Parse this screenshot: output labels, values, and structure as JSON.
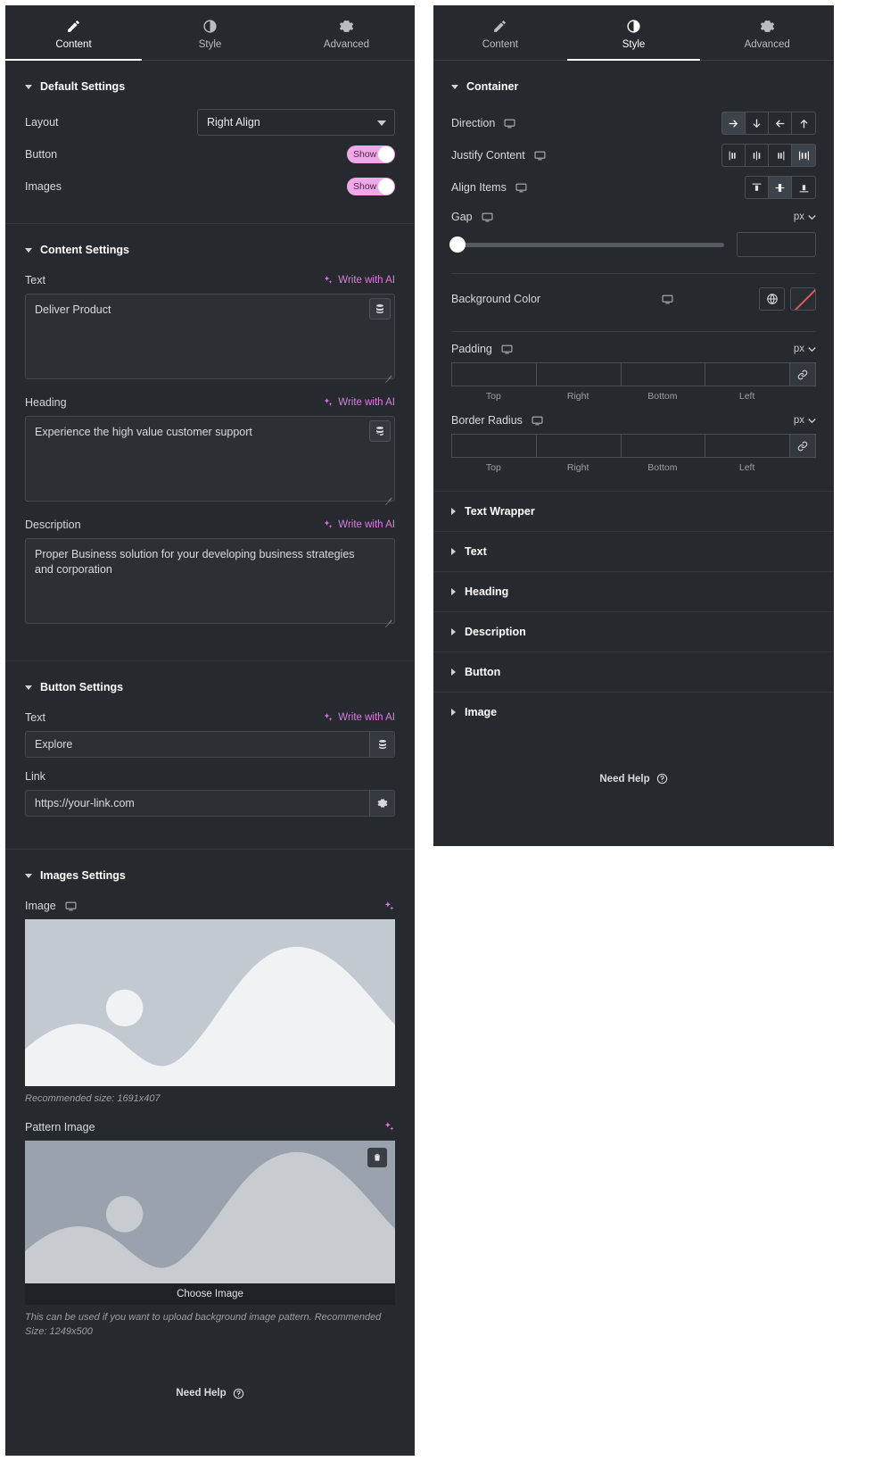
{
  "tabs": {
    "content": "Content",
    "style": "Style",
    "advanced": "Advanced"
  },
  "content_panel": {
    "default_settings": {
      "title": "Default Settings",
      "layout_label": "Layout",
      "layout_value": "Right Align",
      "button_label": "Button",
      "button_toggle": "Show",
      "images_label": "Images",
      "images_toggle": "Show"
    },
    "content_settings": {
      "title": "Content Settings",
      "ai_label": "Write with AI",
      "text_label": "Text",
      "text_value": "Deliver Product",
      "heading_label": "Heading",
      "heading_value": "Experience the high value customer support",
      "description_label": "Description",
      "description_value": "Proper Business solution for your developing business strategies and corporation"
    },
    "button_settings": {
      "title": "Button Settings",
      "ai_label": "Write with AI",
      "text_label": "Text",
      "text_value": "Explore",
      "link_label": "Link",
      "link_value": "https://your-link.com"
    },
    "images_settings": {
      "title": "Images Settings",
      "image_label": "Image",
      "image_note": "Recommended size: 1691x407",
      "pattern_label": "Pattern Image",
      "choose_image": "Choose Image",
      "pattern_note": "This can be used if you want to upload background image pattern. Recommended Size: 1249x500"
    },
    "need_help": "Need Help"
  },
  "style_panel": {
    "container": {
      "title": "Container",
      "direction_label": "Direction",
      "direction_options": [
        "row",
        "column",
        "row-reverse",
        "column-reverse"
      ],
      "direction_active": 0,
      "justify_label": "Justify Content",
      "justify_options": [
        "flex-start",
        "center",
        "flex-end",
        "space-between"
      ],
      "justify_active": 3,
      "align_label": "Align Items",
      "align_options": [
        "flex-start",
        "center",
        "flex-end"
      ],
      "align_active": 1,
      "gap_label": "Gap",
      "gap_unit": "px",
      "gap_value": "",
      "background_label": "Background Color",
      "padding_label": "Padding",
      "padding_unit": "px",
      "padding": {
        "top": "",
        "right": "",
        "bottom": "",
        "left": ""
      },
      "border_radius_label": "Border Radius",
      "border_radius_unit": "px",
      "border_radius": {
        "top": "",
        "right": "",
        "bottom": "",
        "left": ""
      },
      "side_captions": {
        "top": "Top",
        "right": "Right",
        "bottom": "Bottom",
        "left": "Left"
      }
    },
    "collapsed_sections": [
      {
        "label": "Text Wrapper"
      },
      {
        "label": "Text"
      },
      {
        "label": "Heading"
      },
      {
        "label": "Description"
      },
      {
        "label": "Button"
      },
      {
        "label": "Image"
      }
    ],
    "need_help": "Need Help"
  },
  "colors": {
    "panel_bg": "#26292d",
    "accent_pink": "#e07be0",
    "toggle_on": "#f0a8e8",
    "border": "#4a4f55"
  }
}
